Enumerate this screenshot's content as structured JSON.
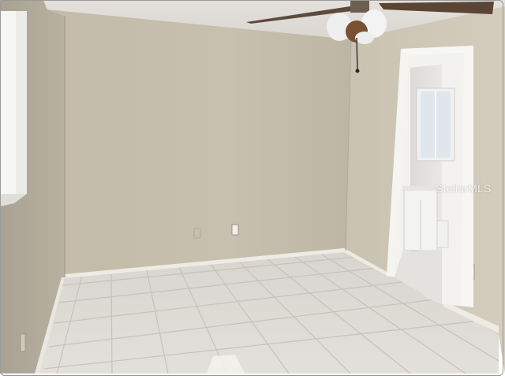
{
  "photo": {
    "alt": "",
    "watermark": "StellarMLS"
  }
}
